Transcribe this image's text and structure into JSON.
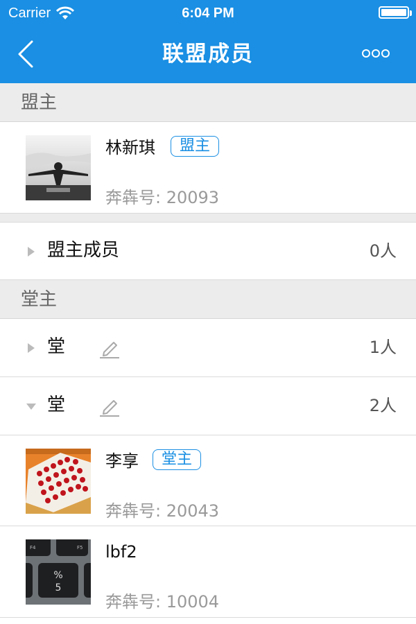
{
  "status_bar": {
    "carrier": "Carrier",
    "time": "6:04 PM"
  },
  "nav": {
    "title": "联盟成员"
  },
  "sections": {
    "leader_header": "盟主",
    "hall_header": "堂主"
  },
  "leader": {
    "name": "林新琪",
    "badge": "盟主",
    "id_text": "奔犇号: 20093"
  },
  "leader_members": {
    "label": "盟主成员",
    "count": "0人"
  },
  "halls": [
    {
      "name": "堂",
      "count": "1人",
      "expanded": false
    },
    {
      "name": "堂",
      "count": "2人",
      "expanded": true
    }
  ],
  "hall_members": [
    {
      "name": "李享",
      "badge": "堂主",
      "id_text": "奔犇号: 20043"
    },
    {
      "name": "lbf2",
      "badge": "",
      "id_text": "奔犇号: 10004"
    }
  ],
  "icons": {
    "back": "chevron-left-icon",
    "more": "more-options-icon",
    "edit": "pencil-icon",
    "collapsed": "triangle-right-icon",
    "expanded": "triangle-down-icon"
  },
  "colors": {
    "brand": "#1a8fe3",
    "section_bg": "#ececec"
  }
}
